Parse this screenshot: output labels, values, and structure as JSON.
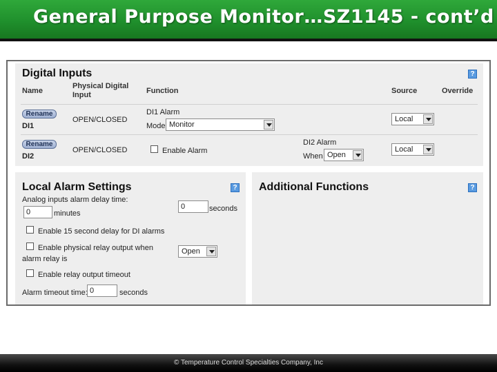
{
  "slide": {
    "title": "General Purpose Monitor…SZ1145 - cont’d",
    "footer": "© Temperature Control Specialties Company, Inc"
  },
  "colors": {
    "banner_green": "#1f8f2c",
    "panel_bg": "#eeeeee",
    "help_blue": "#5a9be0"
  },
  "digital_inputs": {
    "title": "Digital Inputs",
    "help": "?",
    "columns": {
      "name": "Name",
      "physical_line1": "Physical Digital",
      "physical_line2": "Input",
      "function": "Function",
      "source": "Source",
      "override": "Override"
    },
    "rows": [
      {
        "rename_label": "Rename",
        "name": "DI1",
        "physical": "OPEN/CLOSED",
        "function_title": "DI1 Alarm",
        "mode_label": "Mode",
        "mode_value": "Monitor",
        "source_value": "Local"
      },
      {
        "rename_label": "Rename",
        "name": "DI2",
        "physical": "OPEN/CLOSED",
        "enable_alarm_label": "Enable Alarm",
        "alarm_title": "DI2 Alarm",
        "when_label": "When",
        "when_value": "Open",
        "source_value": "Local"
      }
    ]
  },
  "local_alarm": {
    "title": "Local Alarm Settings",
    "help": "?",
    "analog_delay_label": "Analog inputs alarm delay time:",
    "minutes_value": "0",
    "minutes_unit": "minutes",
    "seconds_value": "0",
    "seconds_unit": "seconds",
    "enable_15s_label": "Enable 15 second delay for DI alarms",
    "relay_line1": "Enable physical relay output when",
    "relay_line2": "alarm relay is",
    "relay_value": "Open",
    "relay_timeout_label": "Enable relay output timeout",
    "timeout_label": "Alarm timeout time:",
    "timeout_value": "0",
    "timeout_unit": "seconds"
  },
  "additional": {
    "title": "Additional Functions",
    "help": "?"
  }
}
